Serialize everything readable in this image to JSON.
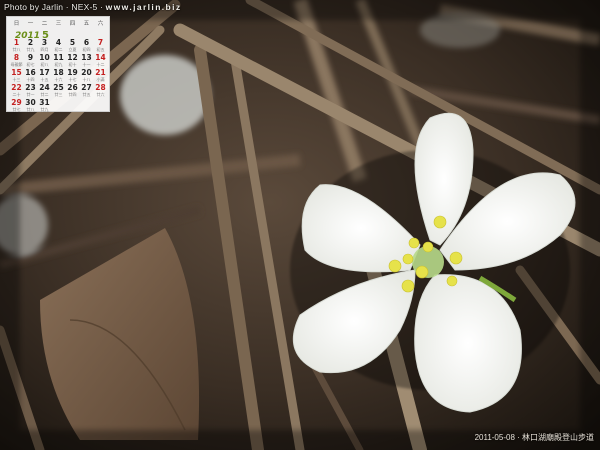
{
  "photo_credit": {
    "photographer": "Photo by Jarlin",
    "camera": "NEX-5",
    "website": "www.jarlin.biz"
  },
  "caption": "2011-05-08 · 林口湖廟殿登山步道",
  "calendar": {
    "year": "2011",
    "month": "5",
    "weekdays": [
      "日",
      "一",
      "二",
      "三",
      "四",
      "五",
      "六"
    ],
    "days": [
      {
        "d": "1",
        "l": "廿八"
      },
      {
        "d": "2",
        "l": "廿九"
      },
      {
        "d": "3",
        "l": "四月"
      },
      {
        "d": "4",
        "l": "初二"
      },
      {
        "d": "5",
        "l": "立夏"
      },
      {
        "d": "6",
        "l": "初四"
      },
      {
        "d": "7",
        "l": "初五"
      },
      {
        "d": "8",
        "l": "母親節"
      },
      {
        "d": "9",
        "l": "初七"
      },
      {
        "d": "10",
        "l": "初八"
      },
      {
        "d": "11",
        "l": "初九"
      },
      {
        "d": "12",
        "l": "初十"
      },
      {
        "d": "13",
        "l": "十一"
      },
      {
        "d": "14",
        "l": "十二"
      },
      {
        "d": "15",
        "l": "十三"
      },
      {
        "d": "16",
        "l": "十四"
      },
      {
        "d": "17",
        "l": "十五"
      },
      {
        "d": "18",
        "l": "十六"
      },
      {
        "d": "19",
        "l": "十七"
      },
      {
        "d": "20",
        "l": "十八"
      },
      {
        "d": "21",
        "l": "小滿"
      },
      {
        "d": "22",
        "l": "二十"
      },
      {
        "d": "23",
        "l": "廿一"
      },
      {
        "d": "24",
        "l": "廿二"
      },
      {
        "d": "25",
        "l": "廿三"
      },
      {
        "d": "26",
        "l": "廿四"
      },
      {
        "d": "27",
        "l": "廿五"
      },
      {
        "d": "28",
        "l": "廿六"
      },
      {
        "d": "29",
        "l": "廿七"
      },
      {
        "d": "30",
        "l": "廿八"
      },
      {
        "d": "31",
        "l": "廿九"
      }
    ],
    "first_weekday": 0
  },
  "colors": {
    "background": "#1d1712",
    "petal": "#f7f7f2",
    "stamen": "#e6e24a",
    "calendar_accent": "#6b8f1a",
    "weekend": "#c41f1f"
  }
}
